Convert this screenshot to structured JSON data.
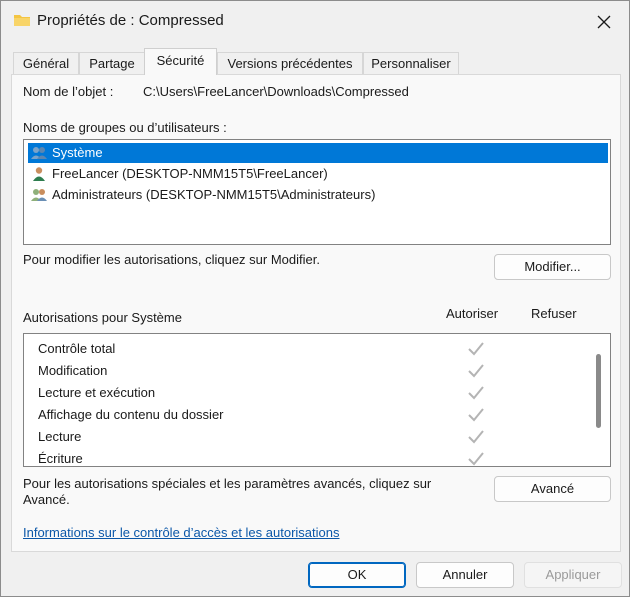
{
  "window": {
    "title": "Propriétés de : Compressed",
    "icon": "folder-icon"
  },
  "tabs": [
    {
      "label": "Général"
    },
    {
      "label": "Partage"
    },
    {
      "label": "Sécurité",
      "active": true
    },
    {
      "label": "Versions précédentes"
    },
    {
      "label": "Personnaliser"
    }
  ],
  "object": {
    "label": "Nom de l’objet :",
    "value": "C:\\Users\\FreeLancer\\Downloads\\Compressed"
  },
  "groups": {
    "label": "Noms de groupes ou d’utilisateurs :",
    "items": [
      {
        "name": "Système",
        "icon": "users-group-icon",
        "selected": true
      },
      {
        "name": "FreeLancer (DESKTOP-NMM15T5\\FreeLancer)",
        "icon": "user-icon",
        "selected": false
      },
      {
        "name": "Administrateurs (DESKTOP-NMM15T5\\Administrateurs)",
        "icon": "admin-group-icon",
        "selected": false
      }
    ]
  },
  "modify": {
    "hint": "Pour modifier les autorisations, cliquez sur Modifier.",
    "button": "Modifier..."
  },
  "permissions": {
    "label": "Autorisations pour Système",
    "col_allow": "Autoriser",
    "col_deny": "Refuser",
    "rows": [
      {
        "name": "Contrôle total",
        "allow": true,
        "deny": false
      },
      {
        "name": "Modification",
        "allow": true,
        "deny": false
      },
      {
        "name": "Lecture et exécution",
        "allow": true,
        "deny": false
      },
      {
        "name": "Affichage du contenu du dossier",
        "allow": true,
        "deny": false
      },
      {
        "name": "Lecture",
        "allow": true,
        "deny": false
      },
      {
        "name": "Écriture",
        "allow": true,
        "deny": false
      }
    ]
  },
  "advanced": {
    "hint_line1": "Pour les autorisations spéciales et les paramètres avancés, cliquez sur",
    "hint_line2": "Avancé.",
    "button": "Avancé"
  },
  "info_link": "Informations sur le contrôle d’accès et les autorisations",
  "footer": {
    "ok": "OK",
    "cancel": "Annuler",
    "apply": "Appliquer"
  },
  "colors": {
    "selection": "#0078d7",
    "link": "#0b57a8",
    "check": "#b4b4b4"
  }
}
